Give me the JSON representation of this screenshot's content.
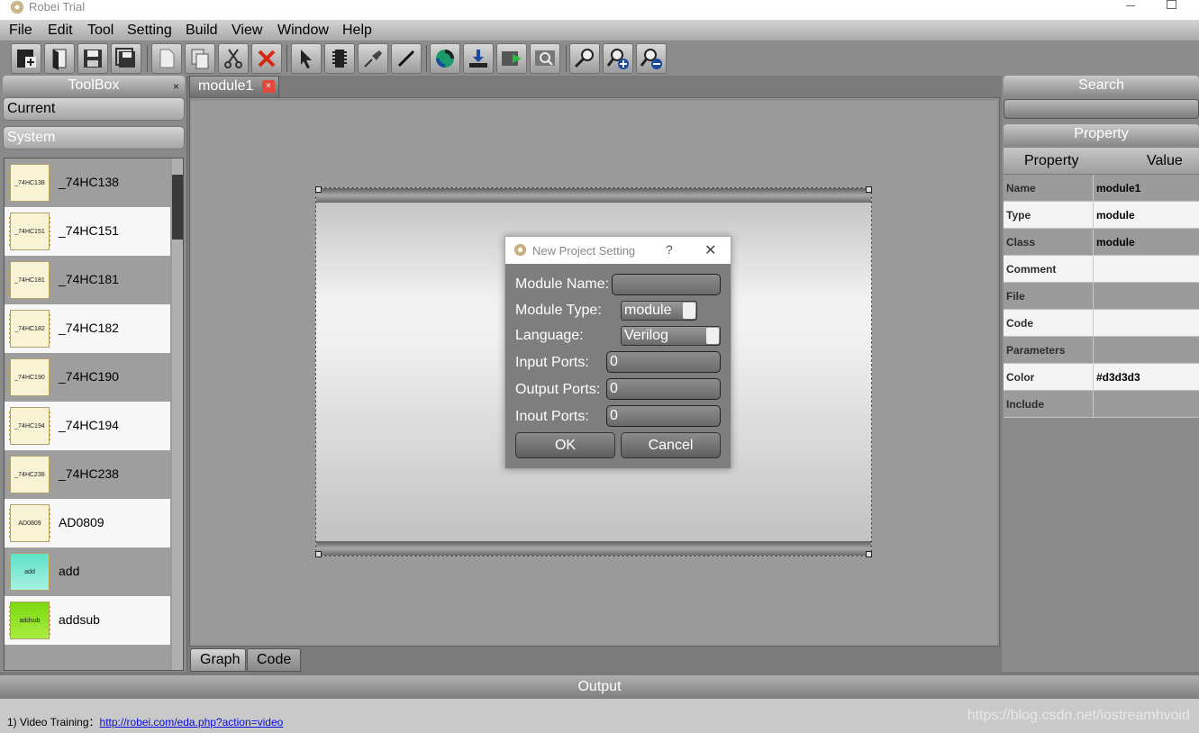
{
  "window": {
    "title": "Robei  Trial"
  },
  "menu": [
    "File",
    "Edit",
    "Tool",
    "Setting",
    "Build",
    "View",
    "Window",
    "Help"
  ],
  "toolbar": {
    "icons": [
      "new-project-icon",
      "open-icon",
      "save-icon",
      "save-all-icon",
      "new-file-icon",
      "copy-icon",
      "cut-icon",
      "delete-icon",
      "pointer-icon",
      "module-icon",
      "pin-icon",
      "wire-icon",
      "execute-icon",
      "download-icon",
      "simulate-icon",
      "view-waveform-icon",
      "zoom-icon",
      "zoom-in-icon",
      "zoom-out-icon"
    ]
  },
  "toolbox": {
    "title": "ToolBox",
    "close": "×",
    "sections": {
      "current": "Current",
      "system": "System"
    },
    "items": [
      {
        "chip": "_74HC138",
        "label": "_74HC138",
        "color": "#f7f3d4"
      },
      {
        "chip": "_74HC151",
        "label": "_74HC151",
        "color": "#f7f3d4"
      },
      {
        "chip": "_74HC181",
        "label": "_74HC181",
        "color": "#f7f3d4"
      },
      {
        "chip": "_74HC182",
        "label": "_74HC182",
        "color": "#f7f3d4"
      },
      {
        "chip": "_74HC190",
        "label": "_74HC190",
        "color": "#f7f3d4"
      },
      {
        "chip": "_74HC194",
        "label": "_74HC194",
        "color": "#f7f3d4"
      },
      {
        "chip": "_74HC238",
        "label": "_74HC238",
        "color": "#f7f3d4"
      },
      {
        "chip": "AD0809",
        "label": "AD0809",
        "color": "#f7f3d4"
      },
      {
        "chip": "add",
        "label": "add",
        "color": "#7fe8cf"
      },
      {
        "chip": "addsub",
        "label": "addsub",
        "color": "#8ee21e"
      }
    ]
  },
  "document": {
    "tab": "module1",
    "tab_close": "×",
    "bottom_tabs": {
      "graph": "Graph",
      "code": "Code"
    }
  },
  "right": {
    "search_title": "Search",
    "property_title": "Property",
    "columns": {
      "property": "Property",
      "value": "Value"
    },
    "rows": [
      {
        "name": "Name",
        "value": "module1"
      },
      {
        "name": "Type",
        "value": "module"
      },
      {
        "name": "Class",
        "value": "module"
      },
      {
        "name": "Comment",
        "value": ""
      },
      {
        "name": "File",
        "value": ""
      },
      {
        "name": "Code",
        "value": ""
      },
      {
        "name": "Parameters",
        "value": ""
      },
      {
        "name": "Color",
        "value": "#d3d3d3"
      },
      {
        "name": "Include",
        "value": ""
      }
    ]
  },
  "output": {
    "title": "Output",
    "line_prefix": "1) Video Training：",
    "link": "http://robei.com/eda.php?action=video",
    "watermark": "https://blog.csdn.net/iostreamhvoid"
  },
  "dialog": {
    "title": "New Project Setting",
    "help": "?",
    "close": "✕",
    "module_name_label": "Module Name:",
    "module_name_value": "",
    "module_type_label": "Module Type:",
    "module_type_value": "module",
    "language_label": "Language:",
    "language_value": "Verilog",
    "input_ports_label": "Input Ports:",
    "input_ports_value": "0",
    "output_ports_label": "Output Ports:",
    "output_ports_value": "0",
    "inout_ports_label": "Inout Ports:",
    "inout_ports_value": "0",
    "ok": "OK",
    "cancel": "Cancel"
  }
}
